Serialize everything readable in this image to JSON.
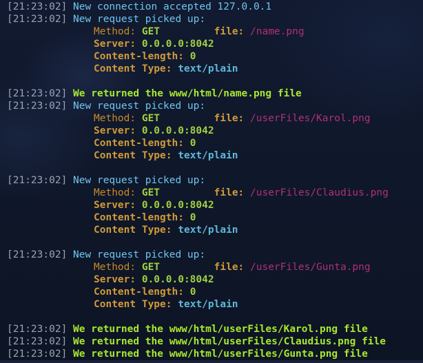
{
  "log": {
    "l1": {
      "ts": "[21:23:02]",
      "msg": "New connection accepted 127.0.0.1"
    },
    "l2": {
      "ts": "[21:23:02]",
      "msg": "New request picked up:"
    },
    "l3": {
      "method_key": "Method:",
      "method_val": "GET",
      "pad": "         ",
      "file_key": "file:",
      "file_val": "/name.png"
    },
    "l4": {
      "key": "Server:",
      "val": "0.0.0.0:8042"
    },
    "l5": {
      "key": "Content-length:",
      "val": "0"
    },
    "l6": {
      "key": "Content Type:",
      "val": "text/plain"
    },
    "l8": {
      "ts": "[21:23:02]",
      "msg": "We returned the www/html/name.png file"
    },
    "l9": {
      "ts": "[21:23:02]",
      "msg": "New request picked up:"
    },
    "l10": {
      "method_key": "Method:",
      "method_val": "GET",
      "pad": "         ",
      "file_key": "file:",
      "file_val": "/userFiles/Karol.png"
    },
    "l11": {
      "key": "Server:",
      "val": "0.0.0.0:8042"
    },
    "l12": {
      "key": "Content-length:",
      "val": "0"
    },
    "l13": {
      "key": "Content Type:",
      "val": "text/plain"
    },
    "l15": {
      "ts": "[21:23:02]",
      "msg": "New request picked up:"
    },
    "l16": {
      "method_key": "Method:",
      "method_val": "GET",
      "pad": "         ",
      "file_key": "file:",
      "file_val": "/userFiles/Claudius.png"
    },
    "l17": {
      "key": "Server:",
      "val": "0.0.0.0:8042"
    },
    "l18": {
      "key": "Content-length:",
      "val": "0"
    },
    "l19": {
      "key": "Content Type:",
      "val": "text/plain"
    },
    "l21": {
      "ts": "[21:23:02]",
      "msg": "New request picked up:"
    },
    "l22": {
      "method_key": "Method:",
      "method_val": "GET",
      "pad": "         ",
      "file_key": "file:",
      "file_val": "/userFiles/Gunta.png"
    },
    "l23": {
      "key": "Server:",
      "val": "0.0.0.0:8042"
    },
    "l24": {
      "key": "Content-length:",
      "val": "0"
    },
    "l25": {
      "key": "Content Type:",
      "val": "text/plain"
    },
    "l27": {
      "ts": "[21:23:02]",
      "msg": "We returned the www/html/userFiles/Karol.png file"
    },
    "l28": {
      "ts": "[21:23:02]",
      "msg": "We returned the www/html/userFiles/Claudius.png file"
    },
    "l29": {
      "ts": "[21:23:02]",
      "msg": "We returned the www/html/userFiles/Gunta.png file"
    }
  },
  "colors": {
    "background": "#0f1526",
    "timestamp": "#9aa3b5",
    "info": "#6fc6f0",
    "returned": "#a8e830",
    "key": "#d09a3a",
    "value": "#a0d040",
    "content_type": "#5fb8d8",
    "file_path": "#b0307a"
  }
}
